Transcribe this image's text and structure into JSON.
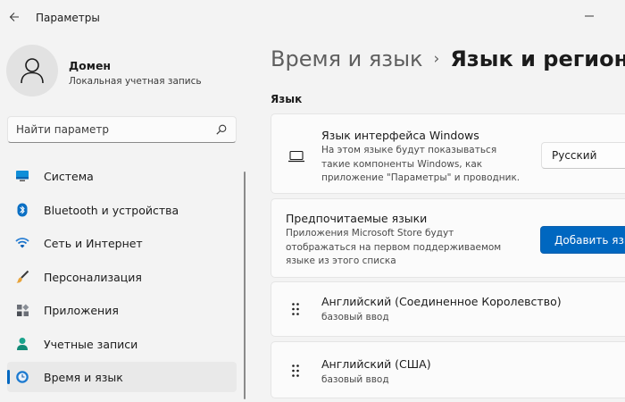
{
  "window": {
    "title": "Параметры"
  },
  "account": {
    "name": "Домен",
    "type": "Локальная учетная запись"
  },
  "search": {
    "placeholder": "Найти параметр"
  },
  "nav": {
    "items": [
      {
        "label": "Система",
        "icon": "system-icon"
      },
      {
        "label": "Bluetooth и устройства",
        "icon": "bluetooth-icon"
      },
      {
        "label": "Сеть и Интернет",
        "icon": "wifi-icon"
      },
      {
        "label": "Персонализация",
        "icon": "brush-icon"
      },
      {
        "label": "Приложения",
        "icon": "apps-icon"
      },
      {
        "label": "Учетные записи",
        "icon": "accounts-icon"
      },
      {
        "label": "Время и язык",
        "icon": "time-language-icon"
      }
    ],
    "active_index": 6
  },
  "breadcrumb": {
    "parent": "Время и язык",
    "separator": "›",
    "current": "Язык и регион"
  },
  "section": {
    "title": "Язык"
  },
  "display_language": {
    "title": "Язык интерфейса Windows",
    "description": "На этом языке будут показываться такие компоненты Windows, как приложение \"Параметры\" и проводник.",
    "selected": "Русский"
  },
  "preferred_languages": {
    "title": "Предпочитаемые языки",
    "description": "Приложения Microsoft Store будут отображаться на первом поддерживаемом языке из этого списка",
    "button_label": "Добавить язык"
  },
  "languages": [
    {
      "name": "Английский (Соединенное Королевство)",
      "sub": "базовый ввод"
    },
    {
      "name": "Английский (США)",
      "sub": "базовый ввод"
    }
  ],
  "colors": {
    "accent": "#0067c0",
    "background": "#f3f3f3",
    "card": "#fbfbfb"
  }
}
